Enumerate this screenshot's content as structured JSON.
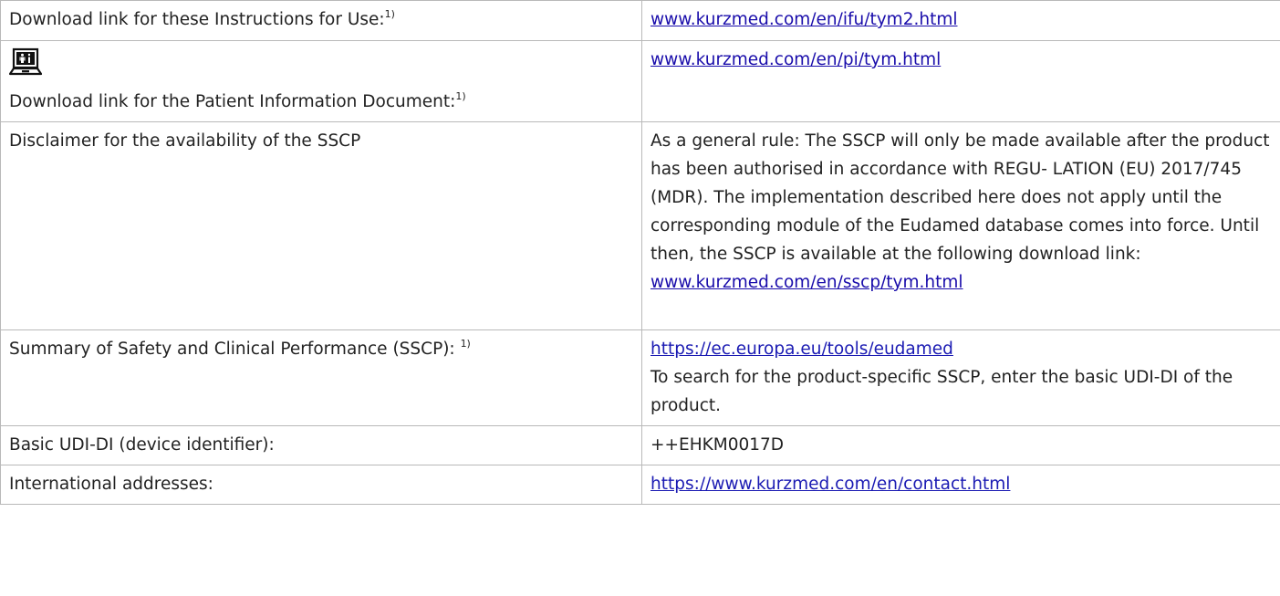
{
  "rows": [
    {
      "label": "Download link for these Instructions for Use:",
      "sup": "1)",
      "link": "www.kurzmed.com/en/ifu/tym2.html"
    },
    {
      "label": "Download link for the Patient Information Document:",
      "sup": "1)",
      "icon": "laptop-patient-info-icon",
      "link": "www.kurzmed.com/en/pi/tym.html"
    },
    {
      "label": "Disclaimer for the availability of the SSCP",
      "text": "As a general rule: The SSCP will only be made available after the product has been authorised in accordance with REGU- LATION (EU) 2017/745 (MDR). The implementation described here does not apply until the corresponding module of the Eudamed database comes into force. Until then, the SSCP is available at the following download link:",
      "link": "www.kurzmed.com/en/sscp/tym.html"
    },
    {
      "label": "Summary of Safety and Clinical Performance (SSCP):",
      "sup": "1)",
      "link": "https://ec.europa.eu/tools/eudamed",
      "text": "To search for the product-specific SSCP, enter the basic UDI-DI of the product."
    },
    {
      "label": "Basic UDI-DI (device identifier):",
      "value": "++EHKM0017D"
    },
    {
      "label": "International addresses:",
      "link": "https://www.kurzmed.com/en/contact.html"
    }
  ]
}
